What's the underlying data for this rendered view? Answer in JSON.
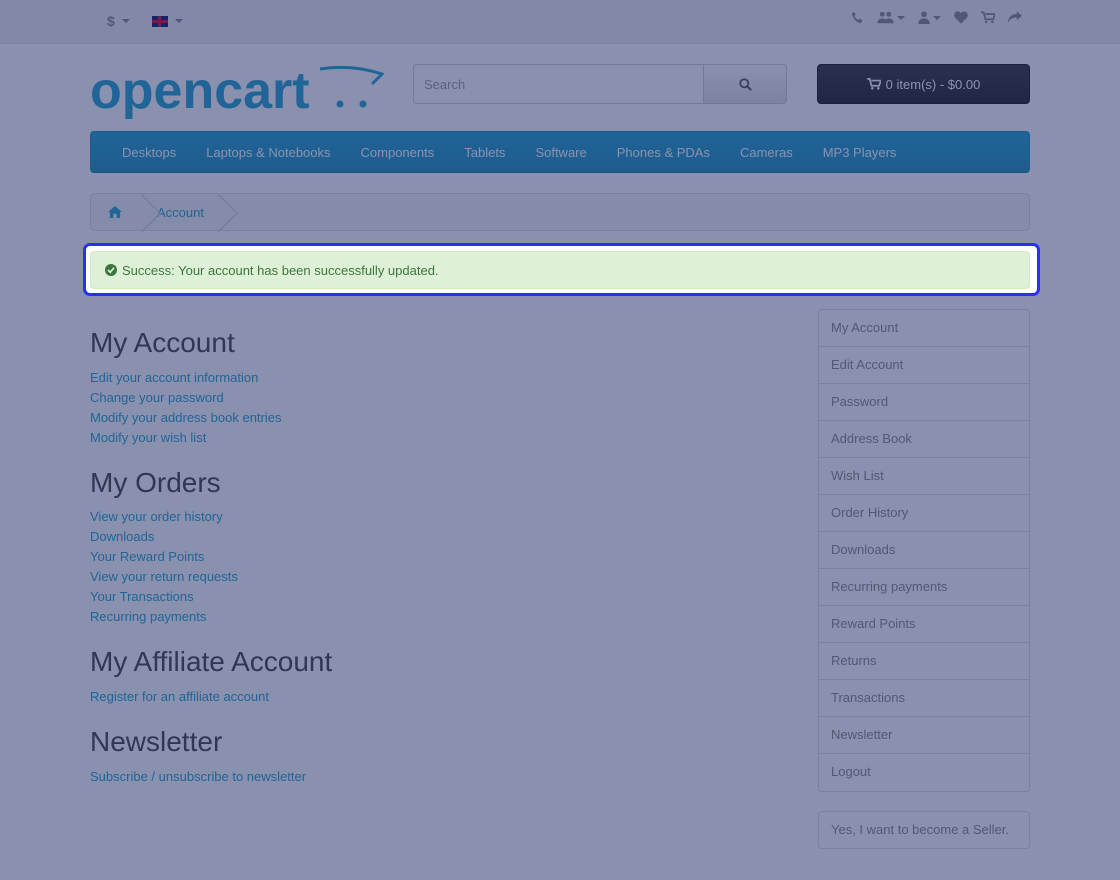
{
  "top_bar": {
    "currency_symbol": "$",
    "language_flag": "uk-flag-icon",
    "icons": [
      "phone-icon",
      "users-icon",
      "user-icon",
      "heart-icon",
      "cart-icon",
      "share-icon"
    ]
  },
  "header": {
    "logo_text": "opencart",
    "search_placeholder": "Search",
    "cart_label": "0 item(s) - $0.00"
  },
  "menu": {
    "items": [
      "Desktops",
      "Laptops & Notebooks",
      "Components",
      "Tablets",
      "Software",
      "Phones & PDAs",
      "Cameras",
      "MP3 Players"
    ]
  },
  "breadcrumb": {
    "items": [
      "Account"
    ]
  },
  "alert": {
    "message": "Success: Your account has been successfully updated."
  },
  "content": {
    "my_account": {
      "title": "My Account",
      "links": [
        "Edit your account information",
        "Change your password",
        "Modify your address book entries",
        "Modify your wish list"
      ]
    },
    "my_orders": {
      "title": "My Orders",
      "links": [
        "View your order history",
        "Downloads",
        "Your Reward Points",
        "View your return requests",
        "Your Transactions",
        "Recurring payments"
      ]
    },
    "affiliate": {
      "title": "My Affiliate Account",
      "links": [
        "Register for an affiliate account"
      ]
    },
    "newsletter": {
      "title": "Newsletter",
      "links": [
        "Subscribe / unsubscribe to newsletter"
      ]
    }
  },
  "sidebar": {
    "items": [
      "My Account",
      "Edit Account",
      "Password",
      "Address Book",
      "Wish List",
      "Order History",
      "Downloads",
      "Recurring payments",
      "Reward Points",
      "Returns",
      "Transactions",
      "Newsletter",
      "Logout"
    ],
    "seller_label": "Yes, I want to become a Seller."
  },
  "colors": {
    "accent": "#23a1d1",
    "highlight": "#2631f2",
    "success_bg": "#dff0d8",
    "success_text": "#3c763d"
  }
}
